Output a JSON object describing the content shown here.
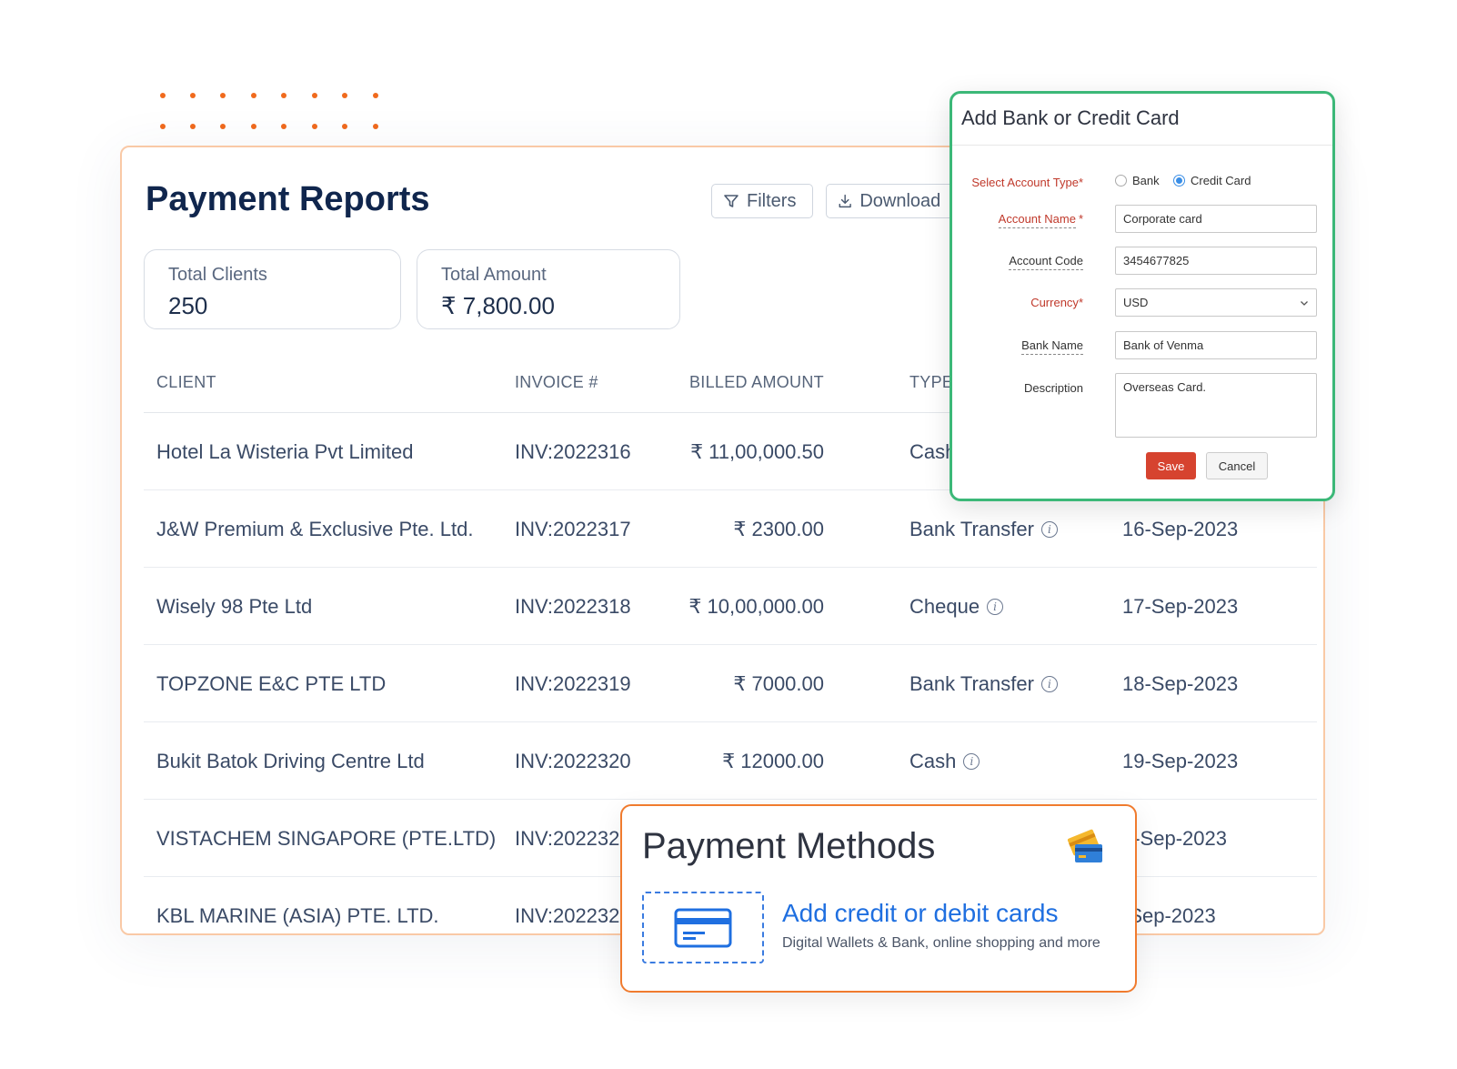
{
  "report": {
    "title": "Payment Reports",
    "filters_label": "Filters",
    "download_label": "Download",
    "stats": {
      "clients_label": "Total Clients",
      "clients_value": "250",
      "amount_label": "Total Amount",
      "amount_value": "₹ 7,800.00"
    },
    "columns": {
      "client": "CLIENT",
      "invoice": "INVOICE #",
      "billed": "BILLED AMOUNT",
      "type": "TYPE"
    },
    "rows": [
      {
        "client": "Hotel La Wisteria Pvt Limited",
        "invoice": "INV:2022316",
        "amount": "₹ 11,00,000.50",
        "type": "Cash",
        "date": ""
      },
      {
        "client": "J&W Premium & Exclusive Pte. Ltd.",
        "invoice": "INV:2022317",
        "amount": "₹ 2300.00",
        "type": "Bank Transfer",
        "date": "16-Sep-2023"
      },
      {
        "client": "Wisely 98 Pte Ltd",
        "invoice": "INV:2022318",
        "amount": "₹ 10,00,000.00",
        "type": "Cheque",
        "date": "17-Sep-2023"
      },
      {
        "client": "TOPZONE E&C PTE LTD",
        "invoice": "INV:2022319",
        "amount": "₹ 7000.00",
        "type": "Bank Transfer",
        "date": "18-Sep-2023"
      },
      {
        "client": "Bukit Batok Driving Centre Ltd",
        "invoice": "INV:2022320",
        "amount": "₹ 12000.00",
        "type": "Cash",
        "date": "19-Sep-2023"
      },
      {
        "client": "VISTACHEM SINGAPORE (PTE.LTD)",
        "invoice": "INV:202232",
        "amount": "",
        "type": "",
        "date": "0-Sep-2023"
      },
      {
        "client": "KBL MARINE (ASIA) PTE. LTD.",
        "invoice": "INV:202232",
        "amount": "",
        "type": "",
        "date": "-Sep-2023"
      }
    ]
  },
  "modal": {
    "title": "Add Bank or Credit Card",
    "account_type_label": "Select Account Type",
    "account_type_options": [
      "Bank",
      "Credit Card"
    ],
    "account_type_selected": "Credit Card",
    "account_name_label": "Account Name",
    "account_name_value": "Corporate card",
    "account_code_label": "Account Code",
    "account_code_value": "3454677825",
    "currency_label": "Currency",
    "currency_value": "USD",
    "bank_name_label": "Bank Name",
    "bank_name_value": "Bank of Venma",
    "description_label": "Description",
    "description_value": "Overseas Card.",
    "required_mark": "*",
    "save_label": "Save",
    "cancel_label": "Cancel"
  },
  "payment_methods": {
    "title": "Payment Methods",
    "add_title": "Add credit or debit cards",
    "add_subtitle": "Digital Wallets & Bank, online shopping and more",
    "icons": [
      "credit-cards-icon",
      "credit-card-icon"
    ]
  },
  "colors": {
    "accent_orange": "#f06a1d",
    "modal_border": "#3cb878",
    "save_button": "#d6432f",
    "link_blue": "#1f6fe0",
    "title_navy": "#10264d"
  }
}
